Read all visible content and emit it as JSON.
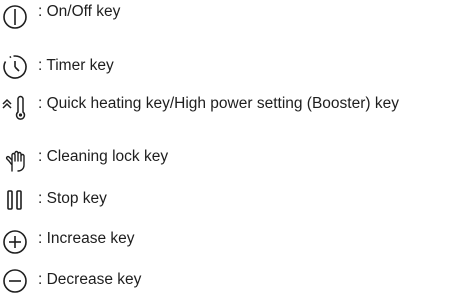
{
  "legend": {
    "items": [
      {
        "icon": "power-icon",
        "label": ": On/Off key"
      },
      {
        "icon": "timer-icon",
        "label": ": Timer key"
      },
      {
        "icon": "booster-icon",
        "label": ": Quick heating key/High power setting (Booster) key"
      },
      {
        "icon": "hand-icon",
        "label": ": Cleaning lock key"
      },
      {
        "icon": "pause-icon",
        "label": ": Stop key"
      },
      {
        "icon": "plus-icon",
        "label": ": Increase key"
      },
      {
        "icon": "minus-icon",
        "label": ": Decrease key"
      }
    ]
  }
}
